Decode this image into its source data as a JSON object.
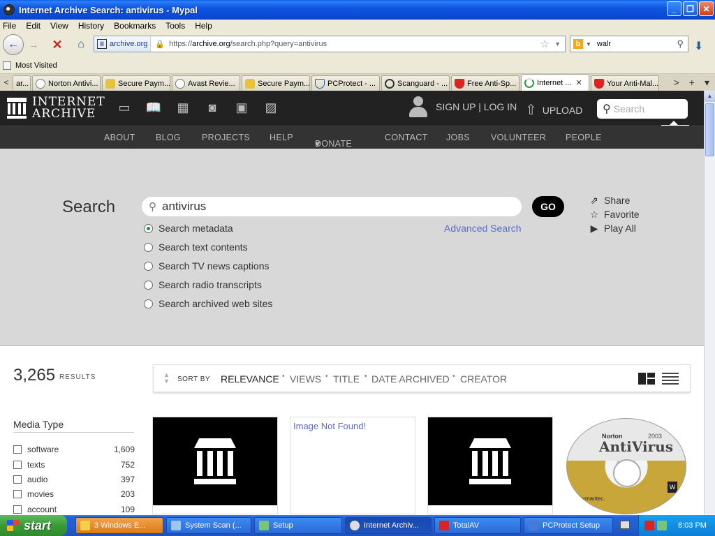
{
  "window": {
    "title": "Internet Archive Search: antivirus - Mypal",
    "minimize": "_",
    "maximize": "❐",
    "close": "✕"
  },
  "menu": [
    {
      "label": "File"
    },
    {
      "label": "Edit"
    },
    {
      "label": "View"
    },
    {
      "label": "History"
    },
    {
      "label": "Bookmarks"
    },
    {
      "label": "Tools"
    },
    {
      "label": "Help"
    }
  ],
  "nav": {
    "site_identity": "archive.org",
    "url_prefix": "https://",
    "url_domain": "archive.org",
    "url_rest": "/search.php?query=antivirus",
    "search_value": "walr"
  },
  "bookmarks": {
    "most_visited": "Most Visited"
  },
  "tabs": [
    {
      "label": "ar...",
      "icon": "none"
    },
    {
      "label": "Norton Antivi...",
      "icon": "chat"
    },
    {
      "label": "Secure Paym...",
      "icon": "lock"
    },
    {
      "label": "Avast Revie...",
      "icon": "chat"
    },
    {
      "label": "Secure Paym...",
      "icon": "lock"
    },
    {
      "label": "PCProtect - ...",
      "icon": "shield-blue"
    },
    {
      "label": "Scanguard - ...",
      "icon": "clock"
    },
    {
      "label": "Free Anti-Sp...",
      "icon": "shield-red"
    },
    {
      "label": "Internet ...",
      "icon": "spin",
      "active": true
    },
    {
      "label": "Your Anti-Mal...",
      "icon": "shield-red"
    }
  ],
  "ia": {
    "logo_line1": "INTERNET",
    "logo_line2": "ARCHIVE",
    "signup_login": "SIGN UP | LOG IN",
    "upload": "UPLOAD",
    "search_placeholder": "Search",
    "nav": [
      {
        "label": "ABOUT"
      },
      {
        "label": "BLOG"
      },
      {
        "label": "PROJECTS"
      },
      {
        "label": "HELP"
      },
      {
        "label": "DONATE"
      },
      {
        "label": "CONTACT"
      },
      {
        "label": "JOBS"
      },
      {
        "label": "VOLUNTEER"
      },
      {
        "label": "PEOPLE"
      }
    ],
    "search_heading": "Search",
    "query": "antivirus",
    "go": "GO",
    "advanced_search": "Advanced Search",
    "options": [
      {
        "label": "Search metadata",
        "selected": true
      },
      {
        "label": "Search text contents",
        "selected": false
      },
      {
        "label": "Search TV news captions",
        "selected": false
      },
      {
        "label": "Search radio transcripts",
        "selected": false
      },
      {
        "label": "Search archived web sites",
        "selected": false
      }
    ],
    "actions": [
      {
        "label": "Share",
        "icon": "share-icon"
      },
      {
        "label": "Favorite",
        "icon": "star-icon"
      },
      {
        "label": "Play All",
        "icon": "play-icon"
      }
    ],
    "results_count": "3,265",
    "results_label": "RESULTS",
    "sort_by": "SORT BY",
    "sort_options": [
      {
        "label": "RELEVANCE"
      },
      {
        "label": "VIEWS"
      },
      {
        "label": "TITLE"
      },
      {
        "label": "DATE ARCHIVED"
      },
      {
        "label": "CREATOR"
      }
    ],
    "facet_title": "Media Type",
    "facets": [
      {
        "label": "software",
        "count": "1,609"
      },
      {
        "label": "texts",
        "count": "752"
      },
      {
        "label": "audio",
        "count": "397"
      },
      {
        "label": "movies",
        "count": "203"
      },
      {
        "label": "account",
        "count": "109"
      }
    ],
    "cards": [
      {
        "type": "ia-logo"
      },
      {
        "type": "not-found",
        "text": "Image Not Found!"
      },
      {
        "type": "ia-logo"
      },
      {
        "type": "cd",
        "brand": "Norton",
        "product": "AntiVirus",
        "year": "2003",
        "logo": "symantec."
      }
    ]
  },
  "taskbar": {
    "start": "start",
    "tasks": [
      {
        "label": "3 Windows E..."
      },
      {
        "label": "System Scan (..."
      },
      {
        "label": "Setup"
      },
      {
        "label": "Internet Archiv..."
      },
      {
        "label": "TotalAV"
      },
      {
        "label": "PCProtect Setup"
      }
    ],
    "time": "8:03 PM"
  }
}
